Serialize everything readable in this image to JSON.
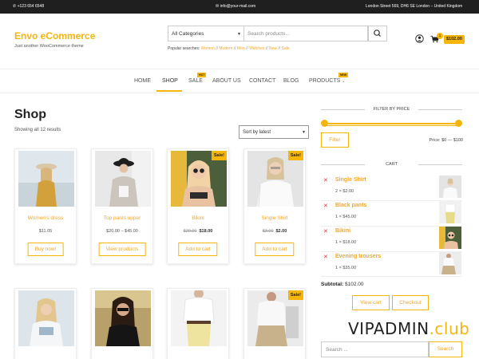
{
  "topbar": {
    "phone": "+123 654 6548",
    "email": "info@your-mail.com",
    "address": "London Street 569, DH6 SE London – United Kingdom"
  },
  "header": {
    "site_title": "Envo eCommerce",
    "tagline": "Just another WooCommerce theme",
    "category_select": "All Categories",
    "search_placeholder": "Search products...",
    "popular_label": "Popular searches:",
    "popular_links": [
      "Women",
      "Modern",
      "Men",
      "Watches",
      "New",
      "Sale"
    ],
    "cart_count": "1",
    "cart_total": "$102.00"
  },
  "nav": {
    "items": [
      "HOME",
      "SHOP",
      "SALE",
      "ABOUT US",
      "CONTACT",
      "BLOG",
      "PRODUCTS"
    ],
    "sale_badge": "HOT",
    "products_badge": "NEW"
  },
  "shop": {
    "title": "Shop",
    "result_count": "Showing all 12 results",
    "sort": "Sort by latest",
    "sale_label": "Sale!",
    "products": [
      {
        "name": "Women's dress",
        "price": "$11.05",
        "old_price": "",
        "sale_price": "",
        "button": "Buy now!"
      },
      {
        "name": "Top pants upper",
        "price": "$20.00 – $45.00",
        "old_price": "",
        "sale_price": "",
        "button": "View products"
      },
      {
        "name": "Bikini",
        "price": "",
        "old_price": "$20.00",
        "sale_price": "$18.00",
        "button": "Add to cart"
      },
      {
        "name": "Single Shirt",
        "price": "",
        "old_price": "$3.00",
        "sale_price": "$2.00",
        "button": "Add to cart"
      }
    ]
  },
  "sidebar": {
    "filter_title": "FILTER BY PRICE",
    "filter_button": "Filter",
    "price_range": "Price: $0 — $100",
    "cart_title": "CART",
    "cart_items": [
      {
        "name": "Single Shirt",
        "qty": "2 × $2.00"
      },
      {
        "name": "Black pants",
        "qty": "1 × $45.00"
      },
      {
        "name": "Bikini",
        "qty": "1 × $18.00"
      },
      {
        "name": "Evening trousers",
        "qty": "1 × $35.00"
      }
    ],
    "subtotal_label": "Subtotal:",
    "subtotal_value": "$102.00",
    "view_cart": "View cart",
    "checkout": "Checkout",
    "search_placeholder": "Search ...",
    "search_button": "Search"
  },
  "watermark": {
    "main": "VIPADMIN",
    "suffix": ".club"
  },
  "colors": {
    "accent": "#f5b50a",
    "remove": "#dd3333",
    "topbar": "#1f1f1f"
  }
}
